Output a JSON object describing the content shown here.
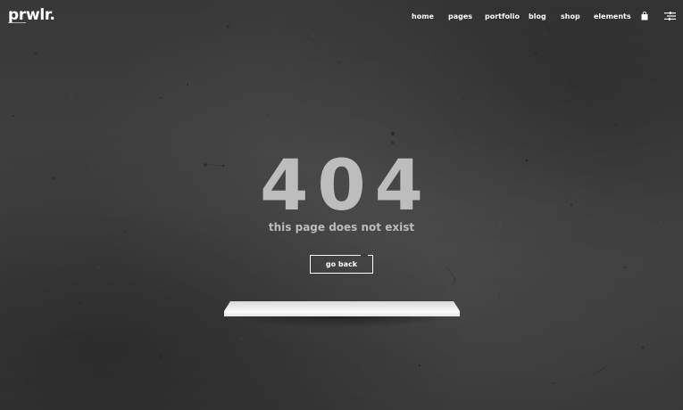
{
  "brand": {
    "logo_text": "prwlr."
  },
  "nav": {
    "items": [
      {
        "label": "home"
      },
      {
        "label": "pages"
      },
      {
        "label": "portfolio"
      },
      {
        "label": "blog"
      },
      {
        "label": "shop"
      },
      {
        "label": "elements"
      }
    ],
    "cart_icon": "shopping-bag-icon",
    "menu_icon": "side-menu-icon"
  },
  "error": {
    "code": "404",
    "message": "this page does not exist",
    "back_button_label": "go back"
  },
  "colors": {
    "background": "#3a3a3a",
    "code_text": "#bdbdbd",
    "nav_text": "#ffffff",
    "shelf": "#f2f2f2"
  }
}
